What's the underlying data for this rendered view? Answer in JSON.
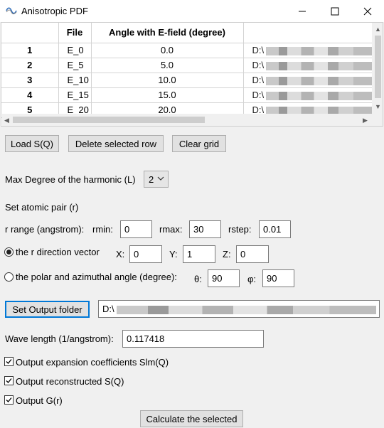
{
  "window": {
    "title": "Anisotropic PDF"
  },
  "grid": {
    "columns": [
      "File",
      "Angle with E-field (degree)",
      ""
    ],
    "rows": [
      {
        "num": "1",
        "file": "E_0",
        "angle": "0.0",
        "path": "D:\\"
      },
      {
        "num": "2",
        "file": "E_5",
        "angle": "5.0",
        "path": "D:\\"
      },
      {
        "num": "3",
        "file": "E_10",
        "angle": "10.0",
        "path": "D:\\"
      },
      {
        "num": "4",
        "file": "E_15",
        "angle": "15.0",
        "path": "D:\\"
      },
      {
        "num": "5",
        "file": "E_20",
        "angle": "20.0",
        "path": "D:\\"
      }
    ]
  },
  "buttons": {
    "load": "Load S(Q)",
    "delete": "Delete selected row",
    "clear": "Clear grid",
    "output_folder": "Set Output folder",
    "calculate": "Calculate the selected"
  },
  "harmonic": {
    "label": "Max Degree of the harmonic (L)",
    "value": "2"
  },
  "atomic_pair": {
    "label": "Set atomic pair (r)"
  },
  "r_range": {
    "label": "r range (angstrom):",
    "rmin_label": "rmin:",
    "rmin": "0",
    "rmax_label": "rmax:",
    "rmax": "30",
    "rstep_label": "rstep:",
    "rstep": "0.01"
  },
  "direction": {
    "label": "the r direction vector",
    "x_label": "X:",
    "x": "0",
    "y_label": "Y:",
    "y": "1",
    "z_label": "Z:",
    "z": "0",
    "selected": true
  },
  "polar": {
    "label": "the polar and azimuthal angle (degree):",
    "theta_label": "θ:",
    "theta": "90",
    "phi_label": "φ:",
    "phi": "90",
    "selected": false
  },
  "output": {
    "path": "D:\\"
  },
  "wavelength": {
    "label": "Wave length (1/angstrom):",
    "value": "0.117418"
  },
  "checkboxes": [
    {
      "label": "Output expansion coefficients Slm(Q)",
      "checked": true
    },
    {
      "label": "Output reconstructed S(Q)",
      "checked": true
    },
    {
      "label": "Output G(r)",
      "checked": true
    }
  ]
}
